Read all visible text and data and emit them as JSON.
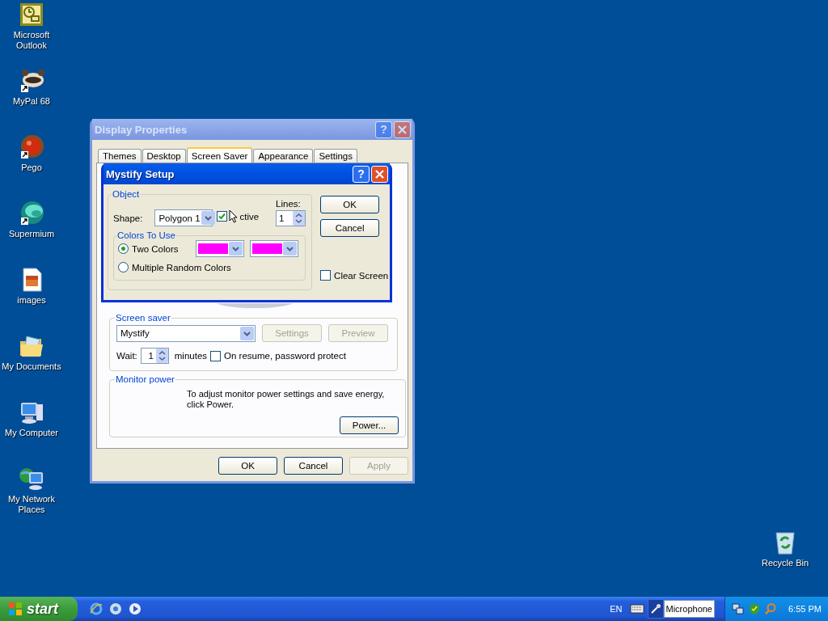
{
  "desktop_icons": [
    {
      "label": "Microsoft Outlook",
      "kind": "outlook"
    },
    {
      "label": "MyPal 68",
      "kind": "raccoon"
    },
    {
      "label": "Pego",
      "kind": "ball"
    },
    {
      "label": "Supermium",
      "kind": "swirl"
    },
    {
      "label": "images",
      "kind": "file"
    },
    {
      "label": "My Documents",
      "kind": "folder"
    },
    {
      "label": "My Computer",
      "kind": "computer"
    },
    {
      "label": "My Network Places",
      "kind": "network"
    }
  ],
  "recycle_bin": {
    "label": "Recycle Bin"
  },
  "display_properties": {
    "title": "Display Properties",
    "help": "?",
    "tabs": [
      {
        "label": "Themes",
        "selected": false
      },
      {
        "label": "Desktop",
        "selected": false
      },
      {
        "label": "Screen Saver",
        "selected": true
      },
      {
        "label": "Appearance",
        "selected": false
      },
      {
        "label": "Settings",
        "selected": false
      }
    ],
    "screen_saver": {
      "title": "Screen saver",
      "value": "Mystify",
      "buttons": [
        {
          "label": "Settings",
          "disabled": true
        },
        {
          "label": "Preview",
          "disabled": true
        }
      ],
      "wait_label": "Wait:",
      "wait_value": "1",
      "minutes_label": "minutes",
      "password_protect": {
        "label": "On resume, password protect",
        "checked": false
      }
    },
    "monitor_power": {
      "title": "Monitor power",
      "text": "To adjust monitor power settings and save energy, click Power.",
      "button": "Power..."
    },
    "buttons": [
      {
        "label": "OK",
        "disabled": false
      },
      {
        "label": "Cancel",
        "disabled": false
      },
      {
        "label": "Apply",
        "disabled": true
      }
    ]
  },
  "mystify_setup": {
    "title": "Mystify Setup",
    "help": "?",
    "object": {
      "title": "Object",
      "shape_label": "Shape:",
      "shape_value": "Polygon 1",
      "active": {
        "label": "ctive",
        "checked": true
      },
      "lines_label": "Lines:",
      "lines_value": "1"
    },
    "colors": {
      "title": "Colors To Use",
      "options": [
        {
          "label": "Two Colors",
          "selected": true
        },
        {
          "label": "Multiple Random Colors",
          "selected": false
        }
      ],
      "swatches": [
        {
          "color": "#ff00ff"
        },
        {
          "color": "#ff00ff"
        }
      ]
    },
    "buttons": [
      {
        "label": "OK"
      },
      {
        "label": "Cancel"
      }
    ],
    "clear_screen": {
      "label": "Clear Screen",
      "checked": false
    }
  },
  "taskbar": {
    "start": "start",
    "language": "EN",
    "toolbar_field": "Microphone",
    "clock": "6:55 PM"
  }
}
